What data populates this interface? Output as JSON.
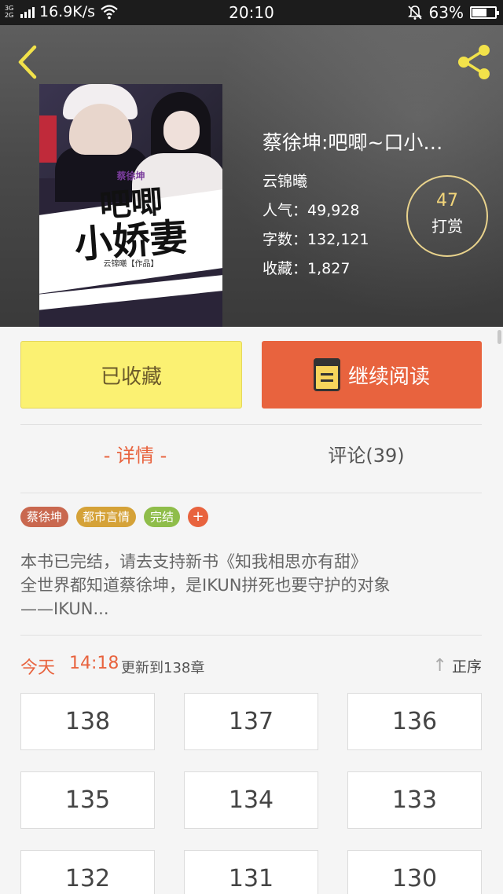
{
  "status_bar": {
    "network_label_top": "3G",
    "network_label_bottom": "2G",
    "speed": "16.9K/s",
    "time": "20:10",
    "battery": "63%",
    "battery_level": 0.63
  },
  "book": {
    "title": "蔡徐坤:吧唧~口小…",
    "author": "云锦曦",
    "popularity_label": "人气：",
    "popularity": "49,928",
    "words_label": "字数：",
    "words": "132,121",
    "favorites_label": "收藏：",
    "favorites": "1,827"
  },
  "cover": {
    "small_text": "蔡徐坤",
    "line1": "吧唧",
    "line2": "小娇妻",
    "byline": "云锦曦【作品】"
  },
  "tip": {
    "count": "47",
    "label": "打赏"
  },
  "actions": {
    "collect_label": "已收藏",
    "read_label": "继续阅读"
  },
  "tabs": {
    "detail": "- 详情 -",
    "comment": "评论(39)"
  },
  "tags": [
    {
      "label": "蔡徐坤",
      "color": "#c9684f"
    },
    {
      "label": "都市言情",
      "color": "#d5a238"
    },
    {
      "label": "完结",
      "color": "#8fbd4a"
    }
  ],
  "tag_add": "+",
  "description": {
    "line1": "本书已完结，请去支持新书《知我相思亦有甜》",
    "line2": "全世界都知道蔡徐坤，是IKUN拼死也要守护的对象",
    "line3": "——IKUN..."
  },
  "update": {
    "day": "今天",
    "time": "14:18",
    "message": "更新到138章",
    "sort_label": "正序"
  },
  "chapters": [
    "138",
    "137",
    "136",
    "135",
    "134",
    "133",
    "132",
    "131",
    "130"
  ],
  "colors": {
    "accent": "#e8633e",
    "collect_bg": "#fbf172",
    "tip_gold": "#f2d57a"
  }
}
